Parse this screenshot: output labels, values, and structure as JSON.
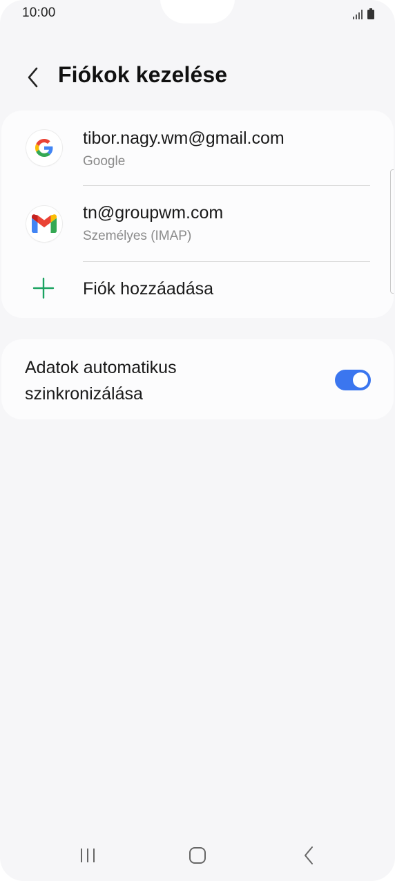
{
  "status_bar": {
    "time": "10:00"
  },
  "header": {
    "title": "Fiókok kezelése",
    "back_icon": "chevron-left-icon"
  },
  "accounts": [
    {
      "email": "tibor.nagy.wm@gmail.com",
      "type": "Google",
      "icon": "google-icon"
    },
    {
      "email": "tn@groupwm.com",
      "type": "Személyes (IMAP)",
      "icon": "gmail-icon"
    }
  ],
  "add_account": {
    "label": "Fiók hozzáadása",
    "icon": "plus-icon"
  },
  "sync": {
    "label": "Adatok automatikus szinkronizálása",
    "enabled": true
  },
  "colors": {
    "accent": "#3b76ef",
    "add_icon": "#1aa260",
    "background": "#f6f6f8",
    "card": "#fcfcfd"
  },
  "nav_bar": {
    "icons": [
      "recent-apps-icon",
      "home-icon",
      "back-icon"
    ]
  }
}
